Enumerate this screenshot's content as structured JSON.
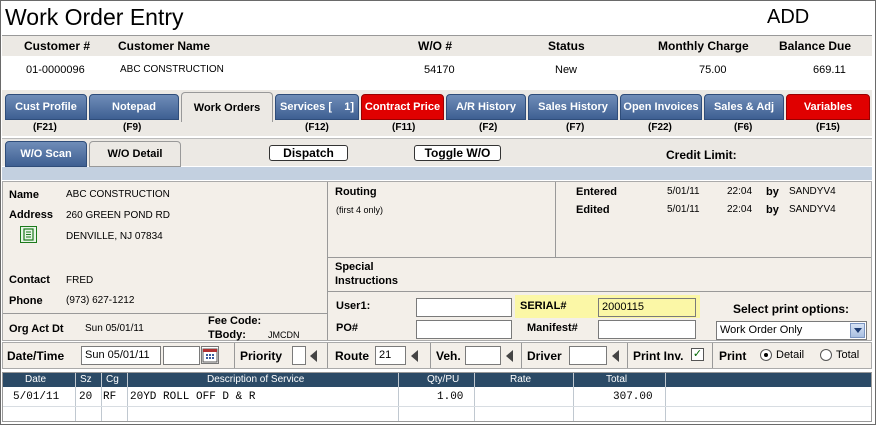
{
  "window": {
    "title": "Work Order Entry",
    "mode": "ADD"
  },
  "summary": {
    "headers": {
      "customer_num": "Customer #",
      "customer_name": "Customer Name",
      "wo_num": "W/O #",
      "status": "Status",
      "monthly_charge": "Monthly Charge",
      "balance_due": "Balance Due"
    },
    "values": {
      "customer_num": "01-0000096",
      "customer_name": "ABC CONSTRUCTION",
      "wo_num": "54170",
      "status": "New",
      "monthly_charge": "75.00",
      "balance_due": "669.11"
    }
  },
  "tabs": [
    {
      "label": "Cust Profile",
      "fkey": "(F21)"
    },
    {
      "label": "Notepad",
      "fkey": "(F9)"
    },
    {
      "label": "Work Orders",
      "fkey": ""
    },
    {
      "label": "Services [    1]",
      "fkey": "(F12)"
    },
    {
      "label": "Contract Price",
      "fkey": "(F11)"
    },
    {
      "label": "A/R History",
      "fkey": "(F2)"
    },
    {
      "label": "Sales History",
      "fkey": "(F7)"
    },
    {
      "label": "Open Invoices",
      "fkey": "(F22)"
    },
    {
      "label": "Sales & Adj",
      "fkey": "(F6)"
    },
    {
      "label": "Variables",
      "fkey": "(F15)"
    }
  ],
  "subtabs": {
    "wo_scan": "W/O Scan",
    "wo_detail": "W/O Detail",
    "dispatch": "Dispatch",
    "toggle": "Toggle W/O",
    "credit_limit": "Credit Limit:"
  },
  "customer": {
    "name_label": "Name",
    "name": "ABC CONSTRUCTION",
    "address_label": "Address",
    "address1": "260 GREEN POND RD",
    "address2": "DENVILLE, NJ 07834",
    "contact_label": "Contact",
    "contact": "FRED",
    "phone_label": "Phone",
    "phone": "(973) 627-1212"
  },
  "routing": {
    "label": "Routing",
    "note": "(first 4 only)"
  },
  "audit": {
    "entered_label": "Entered",
    "entered_date": "5/01/11",
    "entered_time": "22:04",
    "by": "by",
    "entered_by": "SANDYV4",
    "edited_label": "Edited",
    "edited_date": "5/01/11",
    "edited_time": "22:04",
    "edited_by": "SANDYV4"
  },
  "special": {
    "label_line1": "Special",
    "label_line2": "Instructions"
  },
  "fields": {
    "org_act_dt_label": "Org Act Dt",
    "org_act_dt": "Sun 05/01/11",
    "fee_code_label": "Fee Code:",
    "tbody_label": "TBody:",
    "tbody": "JMCDN",
    "user1_label": "User1:",
    "user1": "",
    "po_label": "PO#",
    "po": "",
    "serial_label": "SERIAL#",
    "serial": "2000115",
    "manifest_label": "Manifest#",
    "manifest": "",
    "print_options_label": "Select print options:",
    "print_option": "Work Order Only"
  },
  "bar": {
    "datetime_label": "Date/Time",
    "date": "Sun 05/01/11",
    "time": "",
    "priority_label": "Priority",
    "priority": "",
    "route_label": "Route",
    "route": "21",
    "veh_label": "Veh.",
    "veh": "",
    "driver_label": "Driver",
    "driver": "",
    "print_inv_label": "Print Inv.",
    "print_label": "Print",
    "detail": "Detail",
    "total": "Total"
  },
  "grid": {
    "columns": [
      "Date",
      "Sz",
      "Cg",
      "Description of Service",
      "Qty/PU",
      "Rate",
      "Total"
    ],
    "rows": [
      {
        "date": "5/01/11",
        "sz": "20",
        "cg": "RF",
        "desc": "20YD ROLL OFF D & R",
        "qty": "1.00",
        "rate": "",
        "total": "307.00"
      }
    ]
  }
}
